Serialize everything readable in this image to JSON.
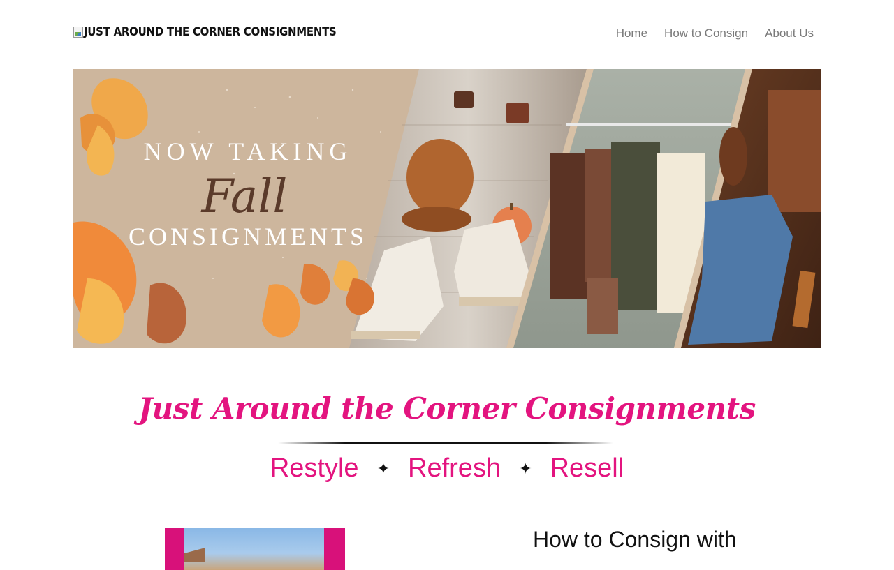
{
  "header": {
    "logo_alt_text": "JUST AROUND THE CORNER CONSIGNMENTS",
    "nav": [
      {
        "label": "Home"
      },
      {
        "label": "How to Consign"
      },
      {
        "label": "About Us"
      }
    ]
  },
  "banner": {
    "line1": "NOW TAKING",
    "line2": "Fall",
    "line3": "CONSIGNMENTS"
  },
  "brand": {
    "title": "Just Around the Corner Consignments",
    "tagline": [
      "Restyle",
      "Refresh",
      "Resell"
    ],
    "separator": "✦"
  },
  "section": {
    "title": "How to Consign with"
  },
  "colors": {
    "brand_pink": "#e3147f",
    "banner_beige": "#cdb69d",
    "nav_text": "#7a7a7a"
  }
}
